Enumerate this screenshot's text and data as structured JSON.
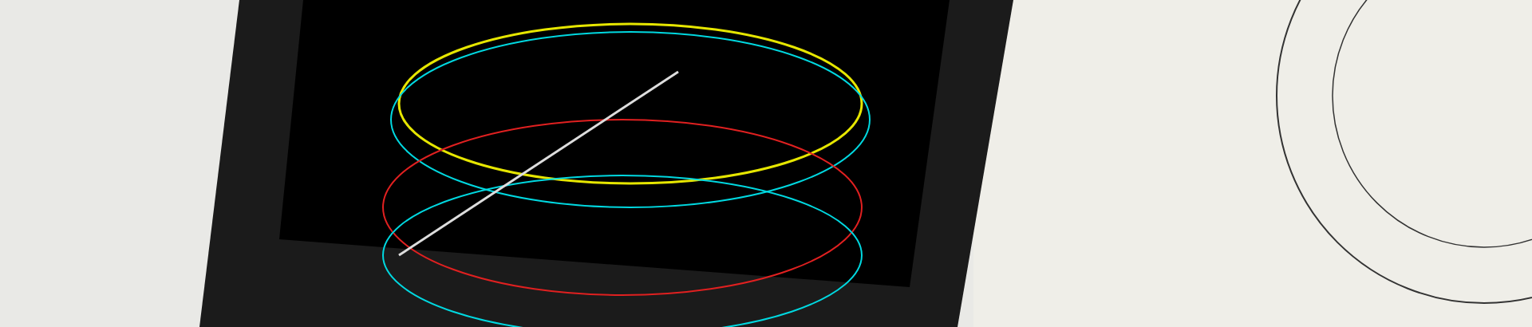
{
  "hero_image": {
    "kind": "photo"
  }
}
